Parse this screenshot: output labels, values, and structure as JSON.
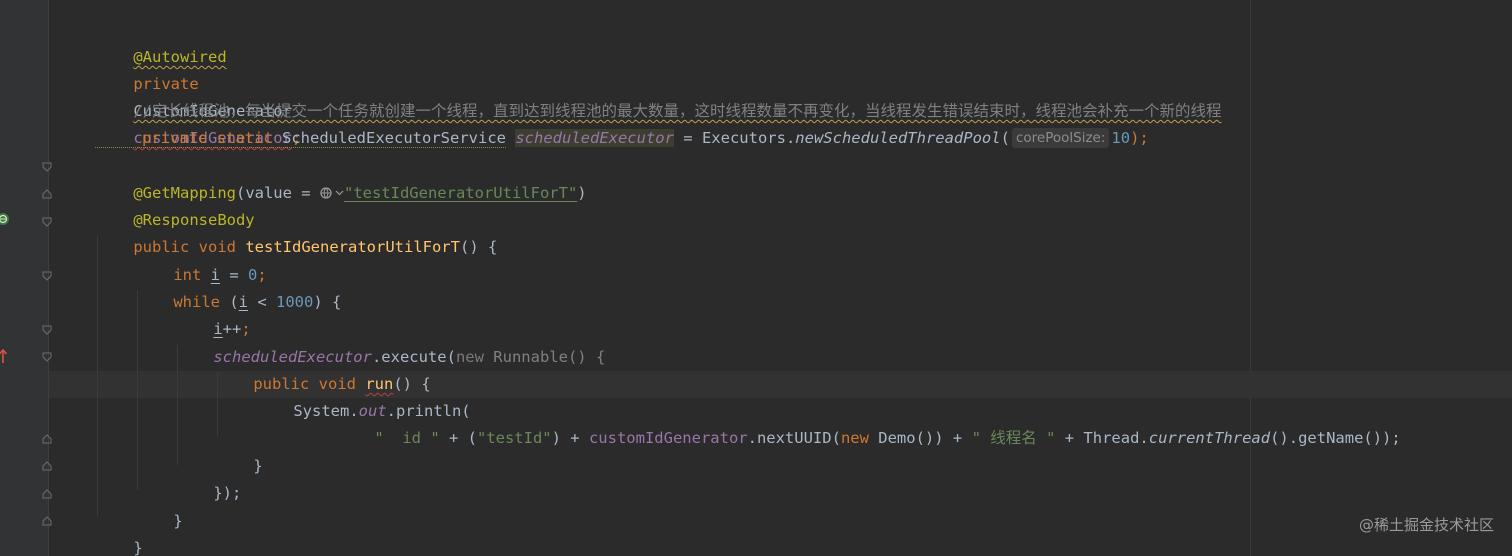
{
  "editor": {
    "lines": {
      "l1": {
        "annotation": "@Autowired"
      },
      "l2": {
        "kw": "private",
        "type": "CustomIdGenerator",
        "field": "customIdGenerator",
        "end": ";"
      },
      "l3": {
        "comment": "//定长线程池，每当提交一个任务就创建一个线程，直到达到线程池的最大数量，这时线程数量不再变化，当线程发生错误结束时，线程池会补充一个新的线程"
      },
      "l4": {
        "kw1": "private",
        "kw2": "static",
        "type": "ScheduledExecutorService",
        "field": "scheduledExecutor",
        "eq": " = Executors.",
        "method": "newScheduledThreadPool",
        "paren_open": "(",
        "hint": "corePoolSize:",
        "value": "10",
        "end": ");"
      },
      "l5": {
        "annotation": "@GetMapping",
        "open": "(value = ",
        "string": "\"testIdGeneratorUtilForT\"",
        "close": ")"
      },
      "l6": {
        "annotation": "@ResponseBody"
      },
      "l7": {
        "kw1": "public",
        "kw2": "void",
        "method": "testIdGeneratorUtilForT",
        "rest": "() {"
      },
      "l8": {
        "kw": "int",
        "var": "i",
        "eq": " = ",
        "value": "0",
        "end": ";"
      },
      "l9": {
        "kw": "while",
        "open": " (",
        "var": "i",
        "cond": " < ",
        "value": "1000",
        "close": ") {"
      },
      "l10": {
        "var": "i",
        "op": "++",
        "end": ";"
      },
      "l11": {
        "field": "scheduledExecutor",
        "call": ".execute(",
        "kw": "new",
        "type": " Runnable() {"
      },
      "l12": {
        "kw1": "public",
        "kw2": "void",
        "method": "run",
        "rest": "() {"
      },
      "l13": {
        "cls": "System.",
        "field": "out",
        "call": ".println("
      },
      "l14": {
        "s1": "\"  id \"",
        "p1": " + (",
        "s2": "\"testId\"",
        "p2": ") + ",
        "field": "customIdGenerator",
        "call": ".nextUUID(",
        "kw": "new",
        "demo": " Demo()) + ",
        "s3": "\" 线程名 \"",
        "p3": " + Thread.",
        "method": "currentThread",
        "end": "().getName());"
      },
      "l15": {
        "text": "}"
      },
      "l16": {
        "text": "});"
      },
      "l17": {
        "text": "}"
      },
      "l18": {
        "text": "}"
      }
    }
  },
  "gutter": {
    "icons": [
      "fold-arrow-icon",
      "web-endpoint-icon",
      "implements-method-icon"
    ]
  },
  "watermark": "@稀土掘金技术社区",
  "colors": {
    "background": "#2b2b2b",
    "keyword": "#cc7832",
    "annotation": "#bbb529",
    "field": "#9876aa",
    "string": "#6a8759",
    "number": "#6897bb",
    "method": "#ffc66d",
    "comment": "#808080",
    "text": "#a9b7c6"
  }
}
